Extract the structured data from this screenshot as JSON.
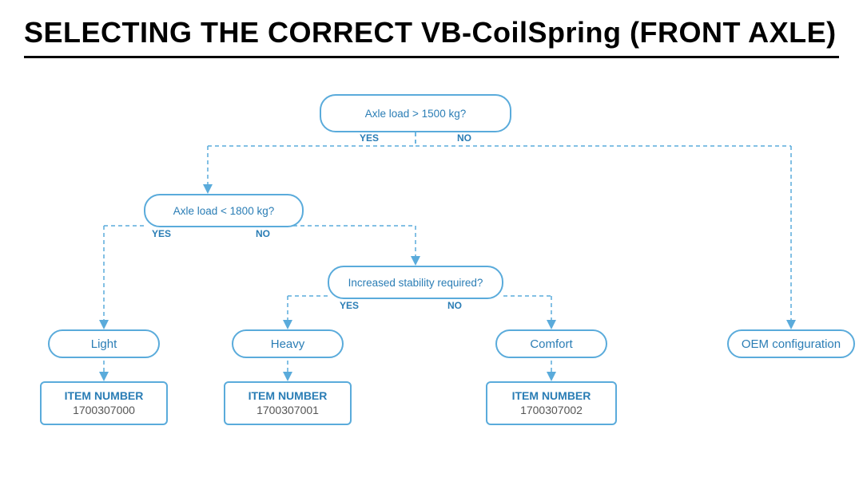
{
  "page": {
    "title": "SELECTING THE CORRECT VB-CoilSpring (FRONT AXLE)"
  },
  "diagram": {
    "decision1": {
      "text": "Axle load > 1500 kg?",
      "yes": "YES",
      "no": "NO"
    },
    "decision2": {
      "text": "Axle load < 1800 kg?",
      "yes": "YES",
      "no": "NO"
    },
    "decision3": {
      "text": "Increased stability required?",
      "yes": "YES",
      "no": "NO"
    },
    "results": {
      "light": "Light",
      "heavy": "Heavy",
      "comfort": "Comfort",
      "oem": "OEM configuration"
    },
    "items": {
      "item0": {
        "label": "ITEM NUMBER",
        "number": "1700307000"
      },
      "item1": {
        "label": "ITEM NUMBER",
        "number": "1700307001"
      },
      "item2": {
        "label": "ITEM NUMBER",
        "number": "1700307002"
      }
    }
  }
}
